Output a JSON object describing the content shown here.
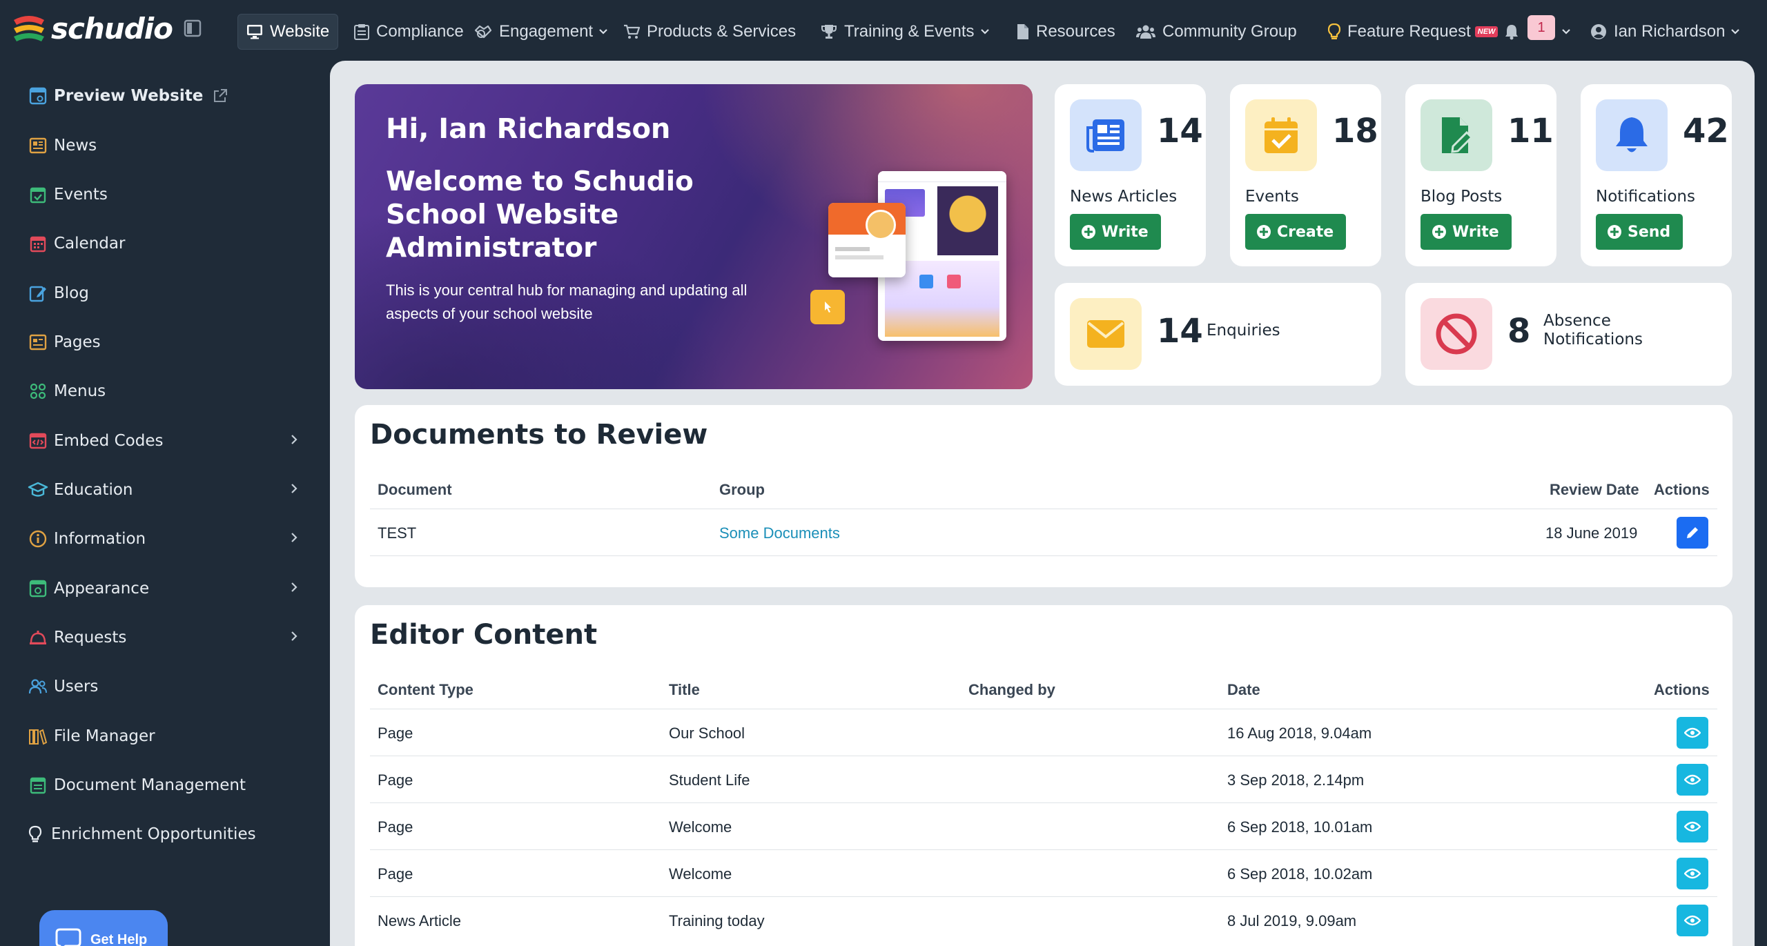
{
  "app": {
    "logo_text": "schudio"
  },
  "topnav": {
    "items": [
      {
        "label": "Website",
        "icon": "monitor-icon"
      },
      {
        "label": "Compliance",
        "icon": "clipboard-icon"
      },
      {
        "label": "Engagement",
        "icon": "handshake-icon"
      },
      {
        "label": "Products & Services",
        "icon": "cart-icon"
      },
      {
        "label": "Training & Events",
        "icon": "trophy-icon"
      },
      {
        "label": "Resources",
        "icon": "file-icon"
      },
      {
        "label": "Community Group",
        "icon": "users-icon"
      },
      {
        "label": "Feature Request",
        "icon": "lightbulb-icon",
        "badge": "NEW"
      }
    ],
    "notifications_count": "1",
    "user_name": "Ian Richardson"
  },
  "sidebar": {
    "items": [
      {
        "label": "Preview Website",
        "icon": "preview-icon",
        "external": true
      },
      {
        "label": "News",
        "icon": "news-icon"
      },
      {
        "label": "Events",
        "icon": "calendar-check-icon"
      },
      {
        "label": "Calendar",
        "icon": "calendar-icon"
      },
      {
        "label": "Blog",
        "icon": "blog-icon"
      },
      {
        "label": "Pages",
        "icon": "pages-icon"
      },
      {
        "label": "Menus",
        "icon": "menus-icon"
      },
      {
        "label": "Embed Codes",
        "icon": "code-icon",
        "expandable": true
      },
      {
        "label": "Education",
        "icon": "graduation-icon",
        "expandable": true
      },
      {
        "label": "Information",
        "icon": "info-icon",
        "expandable": true
      },
      {
        "label": "Appearance",
        "icon": "appearance-icon",
        "expandable": true
      },
      {
        "label": "Requests",
        "icon": "requests-icon",
        "expandable": true
      },
      {
        "label": "Users",
        "icon": "users-icon"
      },
      {
        "label": "File Manager",
        "icon": "books-icon"
      },
      {
        "label": "Document Management",
        "icon": "document-icon"
      },
      {
        "label": "Enrichment Opportunities",
        "icon": "lightbulb-icon"
      }
    ],
    "get_help_label": "Get Help"
  },
  "hero": {
    "greeting": "Hi, Ian Richardson",
    "title": "Welcome to Schudio School Website Administrator",
    "description": "This is your central hub for managing and updating all aspects of your school website"
  },
  "stats": [
    {
      "count": "14",
      "label": "News Articles",
      "button": "Write",
      "icon": "newspaper-icon",
      "color": "#2b6be6"
    },
    {
      "count": "18",
      "label": "Events",
      "button": "Create",
      "icon": "calendar-check-icon",
      "color": "#f4b21f"
    },
    {
      "count": "11",
      "label": "Blog Posts",
      "button": "Write",
      "icon": "file-edit-icon",
      "color": "#1f8a4f"
    },
    {
      "count": "42",
      "label": "Notifications",
      "button": "Send",
      "icon": "bell-icon",
      "color": "#2b6be6"
    }
  ],
  "wide_stats": [
    {
      "count": "14",
      "label": "Enquiries",
      "icon": "envelope-icon",
      "color": "#f4b21f"
    },
    {
      "count": "8",
      "label_line1": "Absence",
      "label_line2": "Notifications",
      "icon": "ban-icon",
      "color": "#d93a4f"
    }
  ],
  "documents": {
    "title": "Documents to Review",
    "headers": {
      "document": "Document",
      "group": "Group",
      "review_date": "Review Date",
      "actions": "Actions"
    },
    "rows": [
      {
        "document": "TEST",
        "group": "Some Documents",
        "review_date": "18 June 2019"
      }
    ]
  },
  "editor": {
    "title": "Editor Content",
    "headers": {
      "content_type": "Content Type",
      "title": "Title",
      "changed_by": "Changed by",
      "date": "Date",
      "actions": "Actions"
    },
    "rows": [
      {
        "content_type": "Page",
        "title": "Our School",
        "changed_by": "",
        "date": "16 Aug 2018, 9.04am"
      },
      {
        "content_type": "Page",
        "title": "Student Life",
        "changed_by": "",
        "date": "3 Sep 2018, 2.14pm"
      },
      {
        "content_type": "Page",
        "title": "Welcome",
        "changed_by": "",
        "date": "6 Sep 2018, 10.01am"
      },
      {
        "content_type": "Page",
        "title": "Welcome",
        "changed_by": "",
        "date": "6 Sep 2018, 10.02am"
      },
      {
        "content_type": "News Article",
        "title": "Training today",
        "changed_by": "",
        "date": "8 Jul 2019, 9.09am"
      }
    ]
  }
}
